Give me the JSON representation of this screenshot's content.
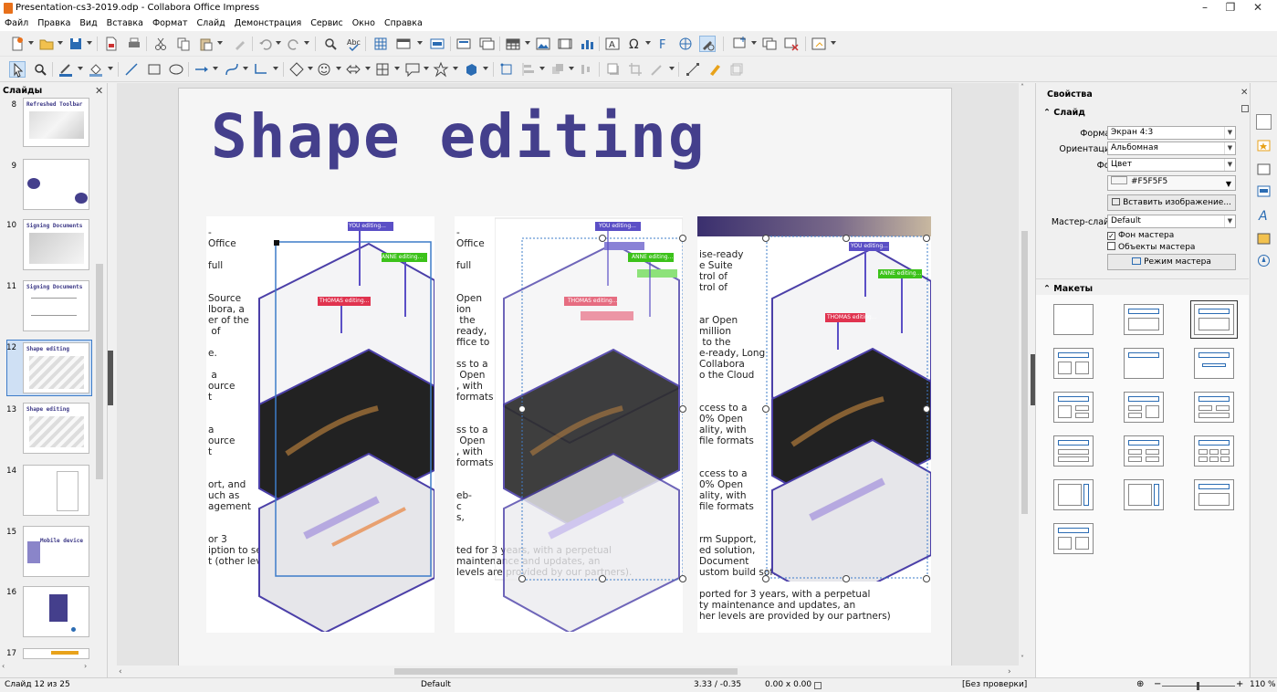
{
  "window": {
    "title": "Presentation-cs3-2019.odp - Collabora Office Impress",
    "minimize": "–",
    "maximize": "❐",
    "close": "✕"
  },
  "menu": [
    "Файл",
    "Правка",
    "Вид",
    "Вставка",
    "Формат",
    "Слайд",
    "Демонстрация",
    "Сервис",
    "Окно",
    "Справка"
  ],
  "slides_panel": {
    "title": "Слайды",
    "close": "✕",
    "slides": [
      {
        "num": "8",
        "title": "Refreshed Toolbar"
      },
      {
        "num": "9",
        "title": ""
      },
      {
        "num": "10",
        "title": "Signing Documents"
      },
      {
        "num": "11",
        "title": "Signing Documents"
      },
      {
        "num": "12",
        "title": "Shape editing"
      },
      {
        "num": "13",
        "title": "Shape editing"
      },
      {
        "num": "14",
        "title": ""
      },
      {
        "num": "15",
        "title": "Mobile device"
      },
      {
        "num": "16",
        "title": ""
      },
      {
        "num": "17",
        "title": ""
      }
    ]
  },
  "slide": {
    "heading": "Shape editing",
    "col1_text": "-\nOffice\n\nfull\n\n\nSource\nlbora, a\ner of the\n of\n\ne.\n\n a\nource\nt\n\n\na\nource\nt\n\n\nort, and\nuch as\nagement\n\n\nor 3\niption to security maintenance and\nt (other levels are provided by our",
    "col2_text": "-\nOffice\n\nfull\n\n\nOpen\nion\n the\nready,\nffice to\n\nss to a\n Open\n, with\nformats\n\n\nss to a\n Open\n, with\nformats\n\n\neb-\nc\ns,\n\n\nted for 3 years, with a perpetual\nmaintenance and updates, an\nlevels are provided by our partners).",
    "col3_text": "ise-ready\ne Suite\ntrol of\ntrol of\n\n\nar Open\nmillion\n to the\ne-ready, Long\nCollabora\no the Cloud\n\n\nccess to a\n0% Open\nality, with\nfile formats\n\n\nccess to a\n0% Open\nality, with\nfile formats\n\n\nrm Support,\ned solution,\nDocument\nustom build software.\n\nported for 3 years, with a perpetual\nty maintenance and updates, an\nher levels are provided by our partners)",
    "tags": {
      "you": "YOU editing...",
      "anne": "ANNE editing...",
      "thomas": "THOMAS editing..."
    }
  },
  "sidebar": {
    "title": "Свойства",
    "close": "✕",
    "section_slide": "Слайд",
    "format_label": "Формат:",
    "format_value": "Экран 4:3",
    "orientation_label": "Ориентация:",
    "orientation_value": "Альбомная",
    "background_label": "Фон:",
    "background_value": "Цвет",
    "color_value": "#F5F5F5",
    "insert_image": "Вставить изображение...",
    "master_label": "Мастер-слайд:",
    "master_value": "Default",
    "master_bg": "Фон мастера",
    "master_objects": "Объекты мастера",
    "master_mode": "Режим мастера",
    "section_layouts": "Макеты"
  },
  "status": {
    "slide": "Слайд 12 из 25",
    "master": "Default",
    "position": "3.33 / -0.35",
    "size": "0.00 x 0.00",
    "language": "[Без проверки]",
    "zoom": "110 %"
  },
  "colors": {
    "accent": "#443f8c",
    "tag_purple": "#5b4fc6",
    "tag_green": "#3cc21a",
    "tag_red": "#e0334f",
    "selection": "#3d7cc9"
  }
}
